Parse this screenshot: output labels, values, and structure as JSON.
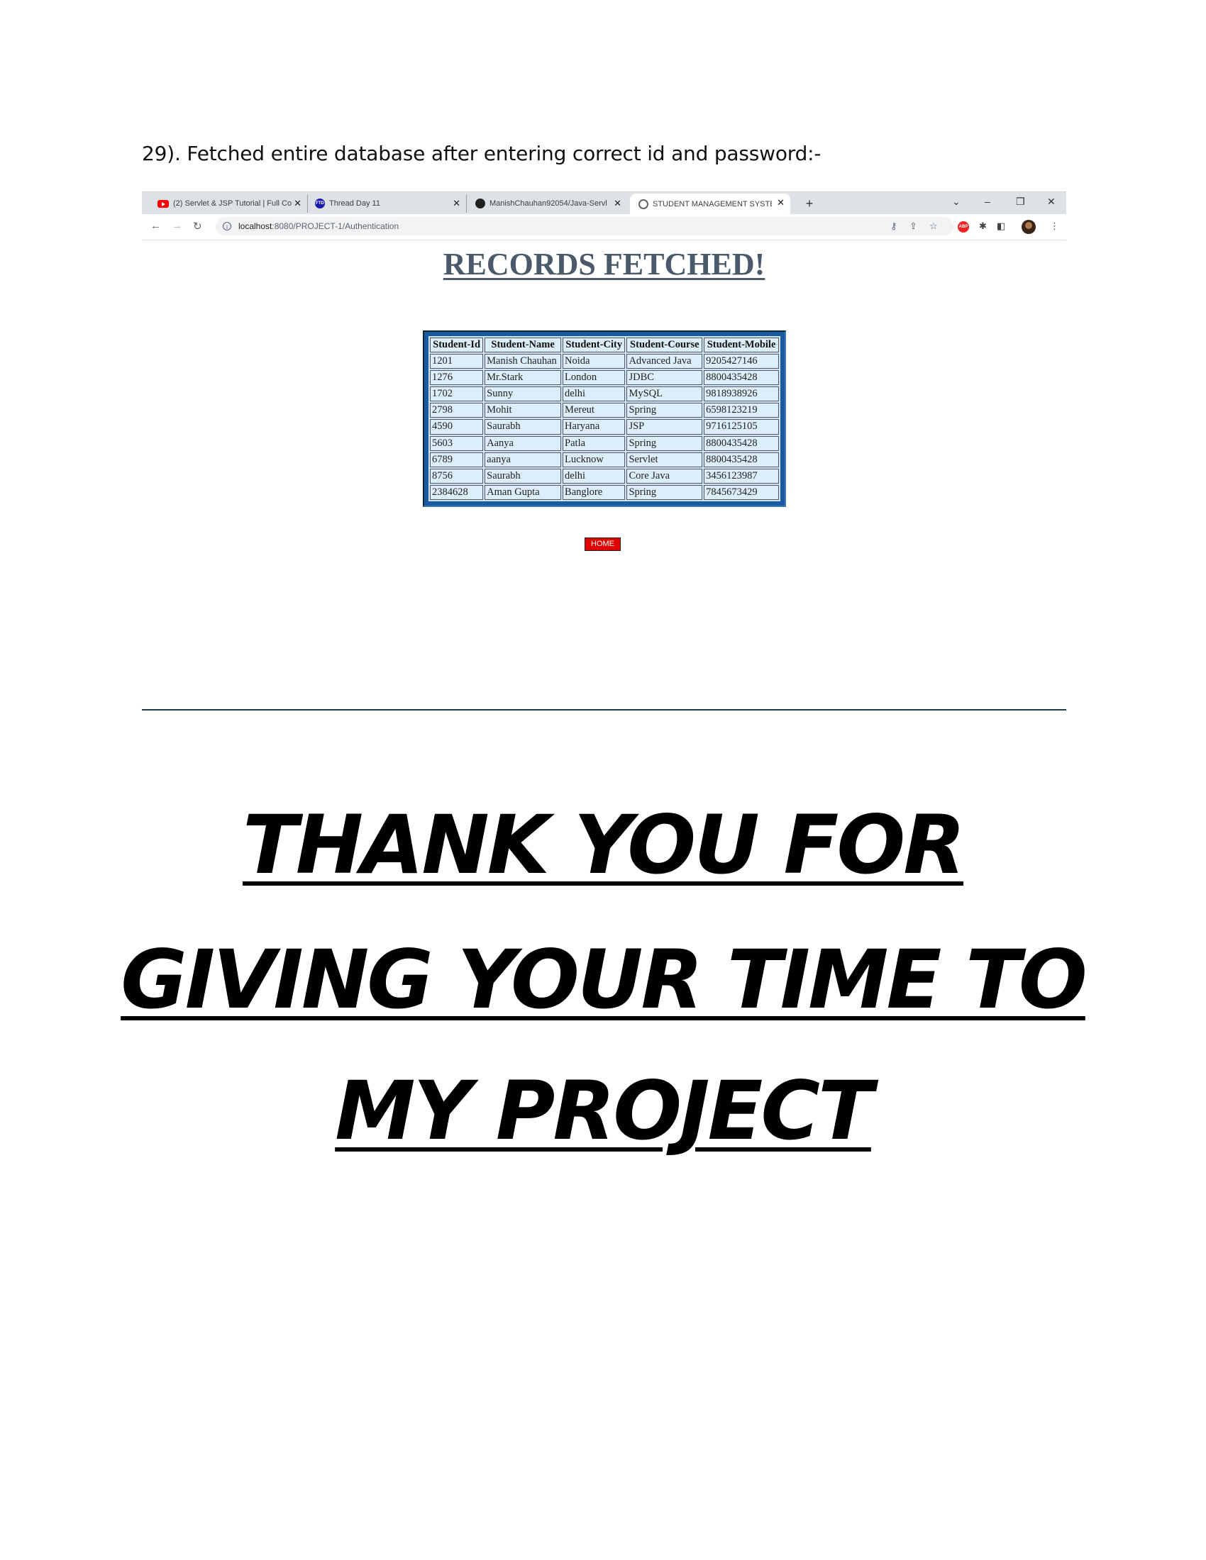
{
  "caption": "29). Fetched entire database after entering correct id and password:-",
  "browser": {
    "tabs": [
      {
        "title": "(2) Servlet & JSP Tutorial | Full Co",
        "icon": "youtube-icon"
      },
      {
        "title": "Thread Day 11",
        "icon": "site-icon"
      },
      {
        "title": "ManishChauhan92054/Java-Servl",
        "icon": "github-icon"
      },
      {
        "title": "STUDENT MANAGEMENT SYSTEM",
        "icon": "globe-icon",
        "active": true
      }
    ],
    "url_host": "localhost",
    "url_path": ":8080/PROJECT-1/Authentication"
  },
  "page": {
    "heading": "RECORDS FETCHED!",
    "home_label": "HOME",
    "columns": [
      "Student-Id",
      "Student-Name",
      "Student-City",
      "Student-Course",
      "Student-Mobile"
    ],
    "rows": [
      [
        "1201",
        "Manish Chauhan",
        "Noida",
        "Advanced Java",
        "9205427146"
      ],
      [
        "1276",
        "Mr.Stark",
        "London",
        "JDBC",
        "8800435428"
      ],
      [
        "1702",
        "Sunny",
        "delhi",
        "MySQL",
        "9818938926"
      ],
      [
        "2798",
        "Mohit",
        "Mereut",
        "Spring",
        "6598123219"
      ],
      [
        "4590",
        "Saurabh",
        "Haryana",
        "JSP",
        "9716125105"
      ],
      [
        "5603",
        "Aanya",
        "Patla",
        "Spring",
        "8800435428"
      ],
      [
        "6789",
        "aanya",
        "Lucknow",
        "Servlet",
        "8800435428"
      ],
      [
        "8756",
        "Saurabh",
        "delhi",
        "Core Java",
        "3456123987"
      ],
      [
        "2384628",
        "Aman Gupta",
        "Banglore",
        "Spring",
        "7845673429"
      ]
    ]
  },
  "thanks": {
    "line1": "THANK YOU FOR",
    "line2": "GIVING YOUR TIME TO",
    "line3": "MY PROJECT"
  }
}
